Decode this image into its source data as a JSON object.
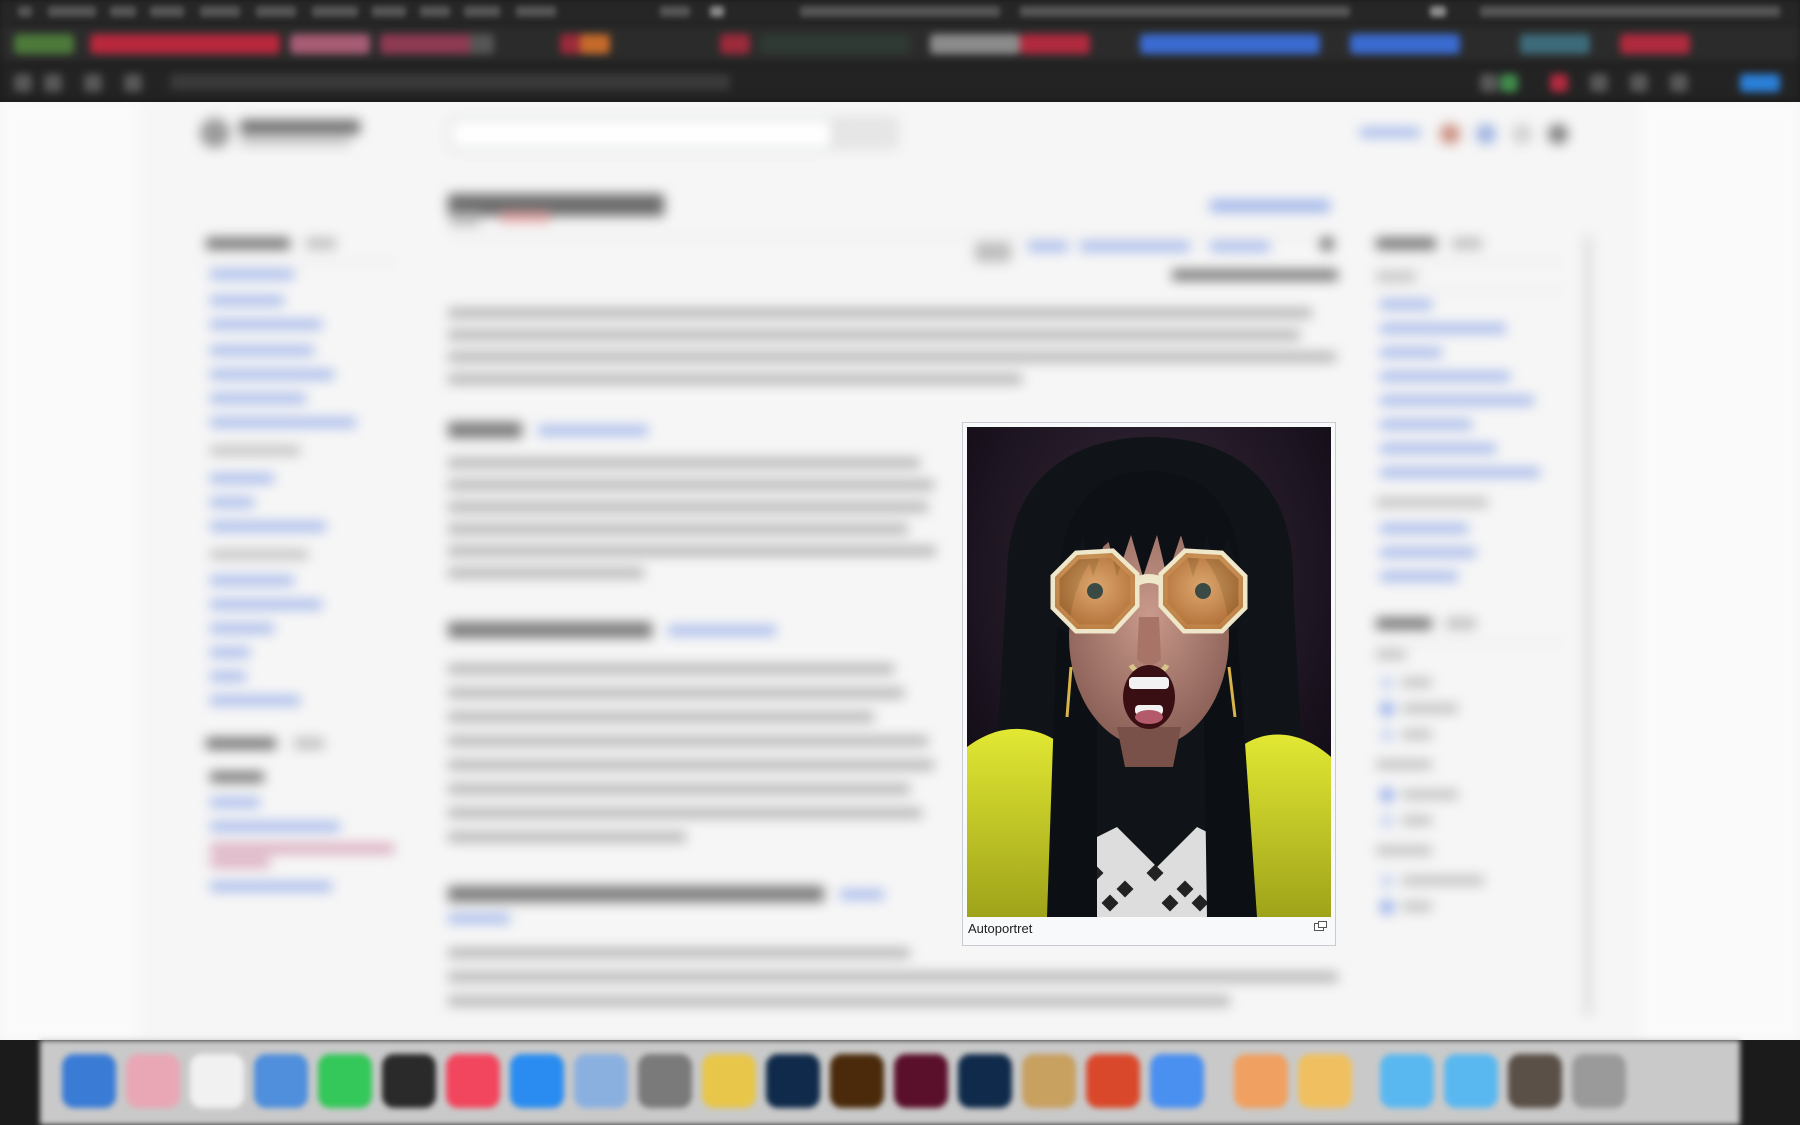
{
  "figure": {
    "caption": "Autoportret",
    "enlarge_icon": "magnify-clip-icon"
  },
  "colors": {
    "toolbar_red": "#b8283c",
    "toolbar_blue": "#3a6bd1",
    "link_blue": "#3366cc",
    "jacket_yellow": "#cfd61f",
    "lens_orange": "#d9883a"
  },
  "dock": {
    "app_icons": [
      "finder-icon",
      "photos-icon",
      "calendar-icon",
      "mail-icon",
      "messages-icon",
      "terminal-icon",
      "music-icon",
      "app-store-icon",
      "preview-icon",
      "calculator-icon",
      "chrome-icon",
      "photoshop-icon",
      "illustrator-icon",
      "indesign-icon",
      "lightroom-icon",
      "notes-icon",
      "powerpoint-icon",
      "safari-icon",
      "books-icon",
      "pages-icon",
      "folder-icon",
      "folder-2-icon",
      "image-icon",
      "trash-icon"
    ]
  }
}
